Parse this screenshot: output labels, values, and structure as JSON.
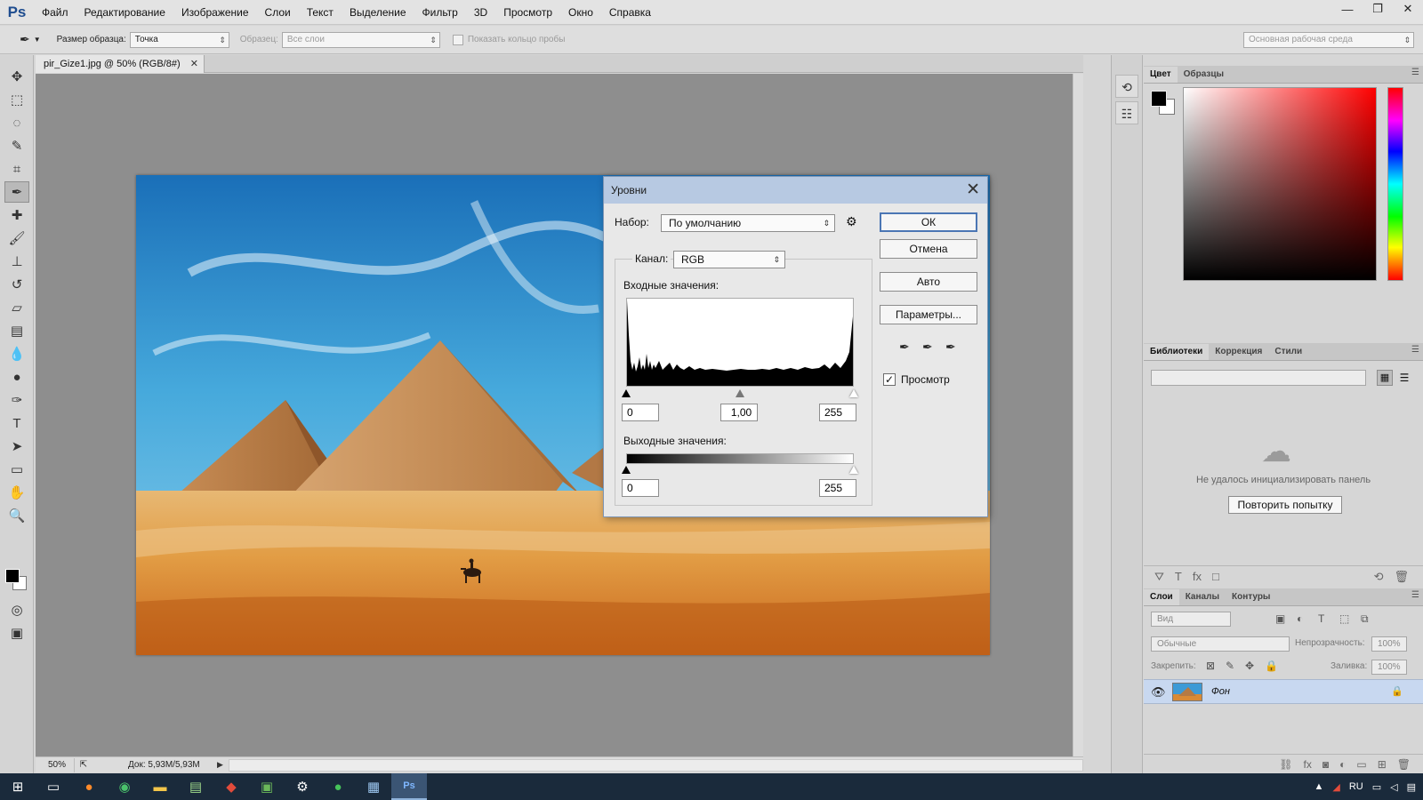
{
  "app": {
    "logo": "Ps"
  },
  "menu": [
    "Файл",
    "Редактирование",
    "Изображение",
    "Слои",
    "Текст",
    "Выделение",
    "Фильтр",
    "3D",
    "Просмотр",
    "Окно",
    "Справка"
  ],
  "window_controls": {
    "minimize": "—",
    "restore": "❐",
    "close": "✕"
  },
  "options_bar": {
    "sample_size_label": "Размер образца:",
    "sample_size_value": "Точка",
    "sample_label": "Образец:",
    "sample_value": "Все слои",
    "show_ring_label": "Показать кольцо пробы",
    "workspace_value": "Основная рабочая среда"
  },
  "document": {
    "tab_title": "pir_Gize1.jpg @ 50% (RGB/8#)",
    "tab_close": "✕"
  },
  "status_bar": {
    "zoom": "50%",
    "doc_size": "Док: 5,93M/5,93M"
  },
  "levels_dialog": {
    "title": "Уровни",
    "preset_label": "Набор:",
    "preset_value": "По умолчанию",
    "channel_label": "Канал:",
    "channel_value": "RGB",
    "input_levels_label": "Входные значения:",
    "input_black": "0",
    "input_gamma": "1,00",
    "input_white": "255",
    "output_levels_label": "Выходные значения:",
    "output_black": "0",
    "output_white": "255",
    "buttons": {
      "ok": "ОК",
      "cancel": "Отмена",
      "auto": "Авто",
      "options": "Параметры..."
    },
    "preview_label": "Просмотр",
    "preview_checked": true
  },
  "color_panel": {
    "tabs": [
      "Цвет",
      "Образцы"
    ],
    "foreground": "#000000",
    "background": "#ffffff",
    "hue": "#ff0000"
  },
  "libraries_panel": {
    "tabs": [
      "Библиотеки",
      "Коррекция",
      "Стили"
    ],
    "error_text": "Не удалось инициализировать панель",
    "retry_label": "Повторить попытку"
  },
  "layers_panel": {
    "tabs": [
      "Слои",
      "Каналы",
      "Контуры"
    ],
    "filter_placeholder": "Вид",
    "blend_mode": "Обычные",
    "opacity_label": "Непрозрачность:",
    "opacity_value": "100%",
    "lock_label": "Закрепить:",
    "fill_label": "Заливка:",
    "fill_value": "100%",
    "layers": [
      {
        "name": "Фон",
        "visible": true,
        "locked": true
      }
    ]
  },
  "taskbar": {
    "language": "RU"
  }
}
